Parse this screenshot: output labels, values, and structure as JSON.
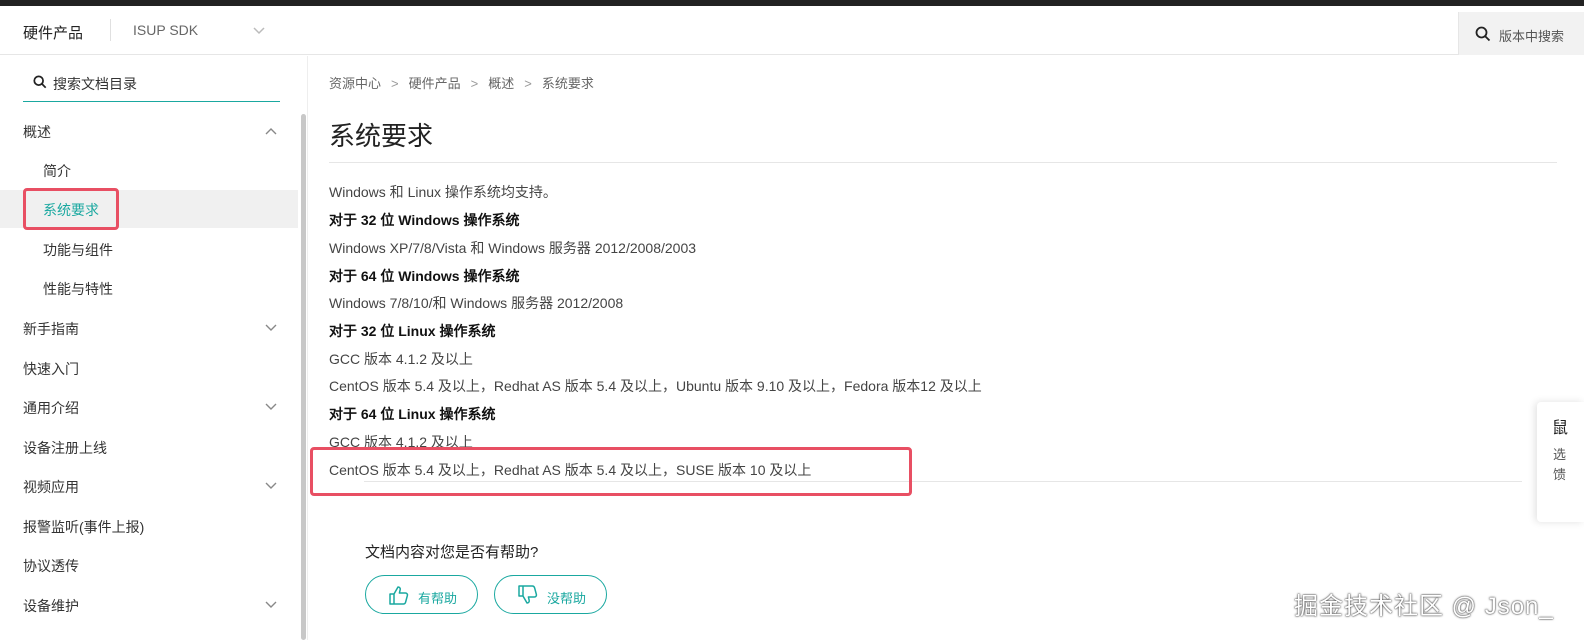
{
  "header": {
    "brand": "硬件产品",
    "product": "ISUP SDK",
    "search_placeholder": "版本中搜索"
  },
  "sidebar": {
    "search_label": "搜索文档目录",
    "items": [
      {
        "label": "概述"
      },
      {
        "label": "简介"
      },
      {
        "label": "系统要求"
      },
      {
        "label": "功能与组件"
      },
      {
        "label": "性能与特性"
      },
      {
        "label": "新手指南"
      },
      {
        "label": "快速入门"
      },
      {
        "label": "通用介绍"
      },
      {
        "label": "设备注册上线"
      },
      {
        "label": "视频应用"
      },
      {
        "label": "报警监听(事件上报)"
      },
      {
        "label": "协议透传"
      },
      {
        "label": "设备维护"
      }
    ]
  },
  "breadcrumb": [
    "资源中心",
    "硬件产品",
    "概述",
    "系统要求"
  ],
  "breadcrumb_sep": ">",
  "page": {
    "title": "系统要求",
    "lines": [
      "Windows 和 Linux 操作系统均支持。",
      "对于 32 位 Windows 操作系统",
      "Windows XP/7/8/Vista 和 Windows 服务器 2012/2008/2003",
      "对于 64 位 Windows 操作系统",
      "Windows 7/8/10/和 Windows 服务器 2012/2008",
      "对于 32 位 Linux 操作系统",
      "GCC 版本 4.1.2 及以上",
      "CentOS 版本 5.4 及以上，Redhat AS 版本 5.4 及以上，Ubuntu 版本 9.10 及以上，Fedora 版本12 及以上",
      "对于 64 位 Linux 操作系统",
      "GCC 版本 4.1.2 及以上",
      "CentOS 版本 5.4 及以上，Redhat AS 版本 5.4 及以上，SUSE 版本 10 及以上"
    ]
  },
  "feedback": {
    "question": "文档内容对您是否有帮助?",
    "helpful": "有帮助",
    "not_helpful": "没帮助"
  },
  "float_card": {
    "title": "鼠",
    "line1": "选",
    "line2": "馈"
  },
  "watermark": "掘金技术社区 @ Json_",
  "colors": {
    "accent": "#1aa8a0",
    "highlight_box": "#e84f63"
  }
}
